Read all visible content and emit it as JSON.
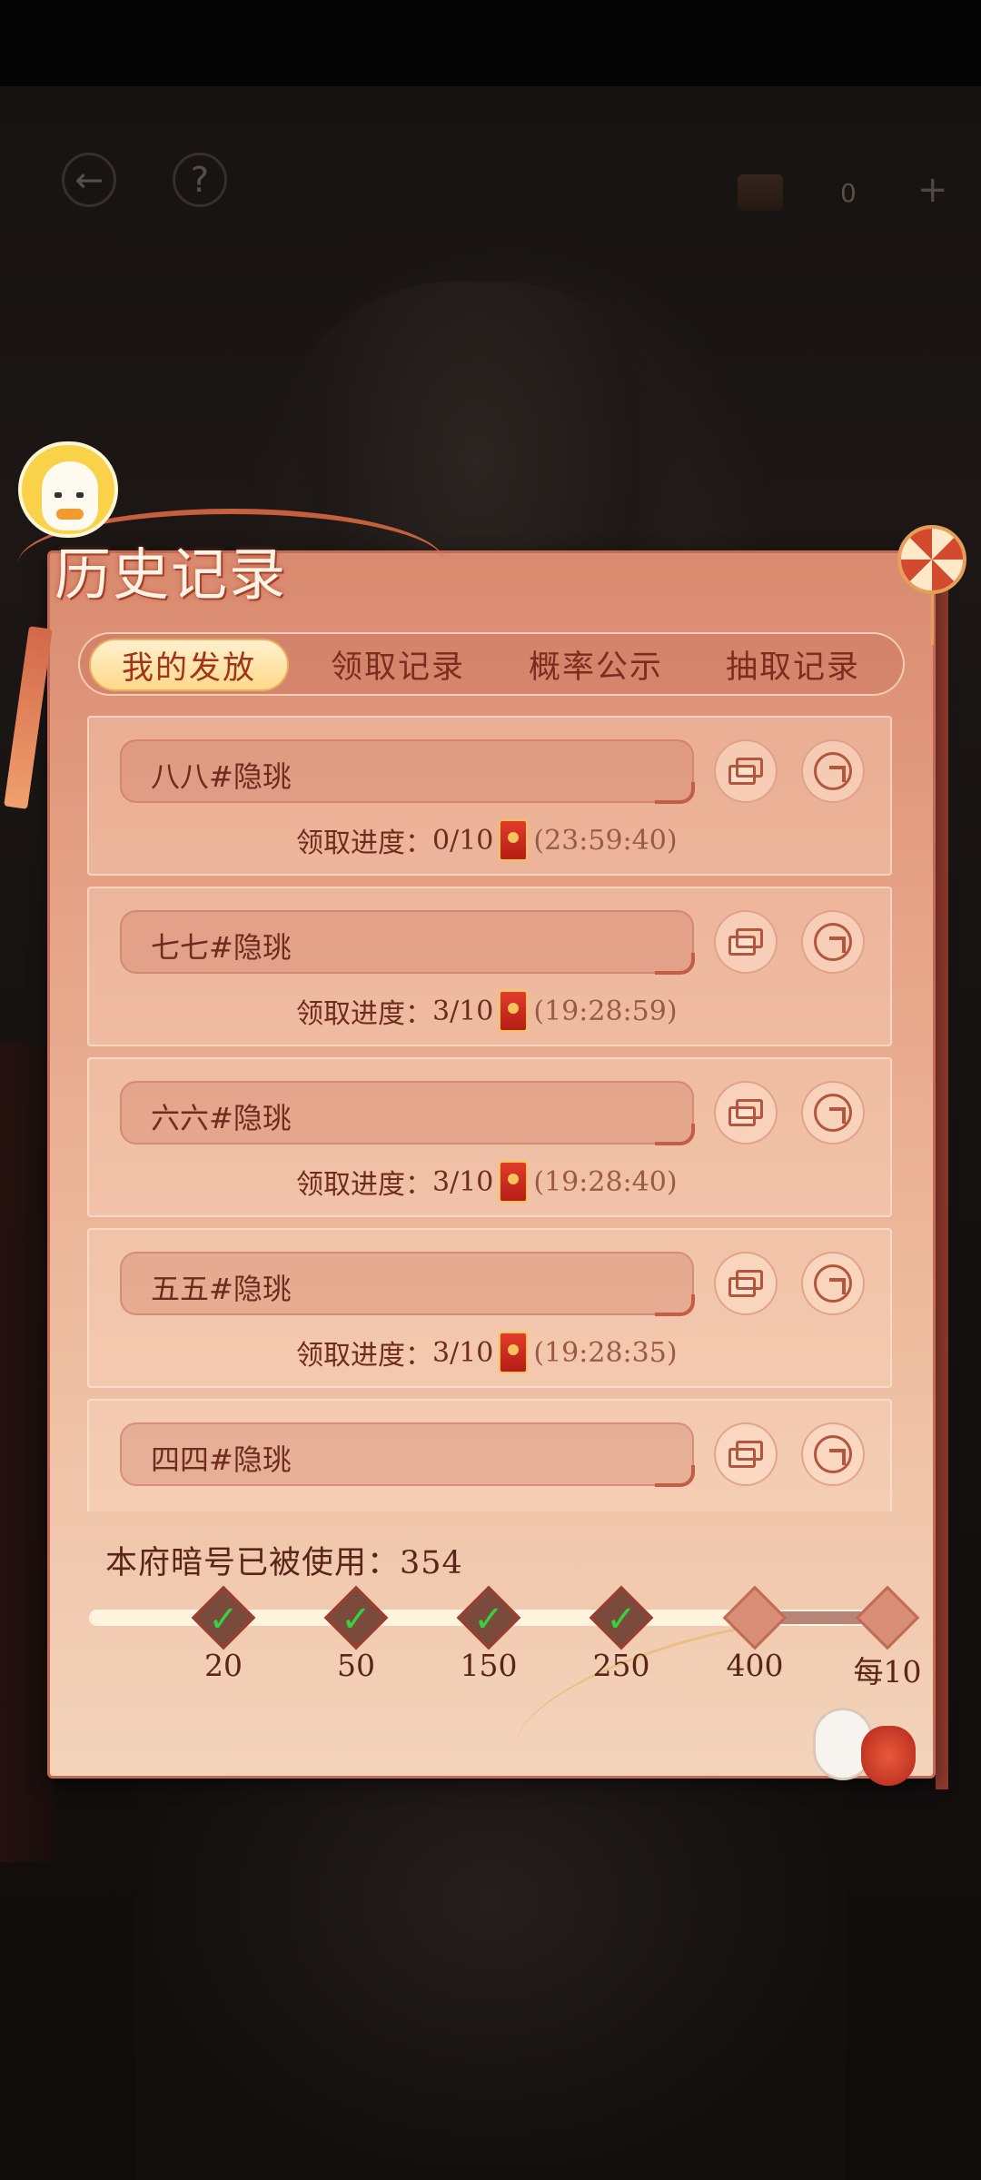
{
  "hud": {
    "back_icon": "back-arrow-icon",
    "help_label": "?",
    "currency_count": "0",
    "plus_label": "+"
  },
  "panel": {
    "title": "历史记录",
    "tabs": [
      {
        "label": "我的发放",
        "active": true
      },
      {
        "label": "领取记录",
        "active": false
      },
      {
        "label": "概率公示",
        "active": false
      },
      {
        "label": "抽取记录",
        "active": false
      }
    ]
  },
  "records": [
    {
      "name": "八八#隐珧",
      "progress_label": "领取进度：",
      "progress": "0/10",
      "time": "(23:59:40)"
    },
    {
      "name": "七七#隐珧",
      "progress_label": "领取进度：",
      "progress": "3/10",
      "time": "(19:28:59)"
    },
    {
      "name": "六六#隐珧",
      "progress_label": "领取进度：",
      "progress": "3/10",
      "time": "(19:28:40)"
    },
    {
      "name": "五五#隐珧",
      "progress_label": "领取进度：",
      "progress": "3/10",
      "time": "(19:28:35)"
    },
    {
      "name": "四四#隐珧"
    }
  ],
  "usage": {
    "label": "本府暗号已被使用：",
    "count": "354",
    "milestones": [
      {
        "label": "20",
        "done": true
      },
      {
        "label": "50",
        "done": true
      },
      {
        "label": "150",
        "done": true
      },
      {
        "label": "250",
        "done": true
      },
      {
        "label": "400",
        "done": false
      },
      {
        "label": "每10",
        "done": false
      }
    ],
    "progress_fraction": 0.83
  },
  "colors": {
    "panel_top": "#d98a6f",
    "panel_bottom": "#f3d4bb",
    "text_dark": "#6e2c1f",
    "accent_red": "#c26a55",
    "check_green": "#36d13e",
    "active_tab": "#ffd98a"
  }
}
